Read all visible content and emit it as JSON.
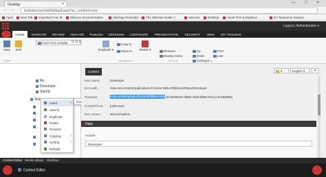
{
  "browser": {
    "tab_title": "Desktop",
    "tab_close": "×",
    "window_controls": "— □ ×",
    "back": "←",
    "forward": "→",
    "url": "test/sitecore/shell/default.aspx?sc_content=core",
    "bookmarks": [
      "Apps",
      "New Tab",
      "Imported From IE",
      "Sitecore Documentation",
      "Sitemap Generator",
      "The Ultimate Guide T...",
      "Sitecore",
      "Desktop",
      "Avoid Thin & Duplicat...",
      "It's Taxonomy Season"
    ]
  },
  "sitecore_header": {
    "user": "Logout  |  Administrator  ▾"
  },
  "ribbon_tabs": [
    "HOME",
    "NAVIGATE",
    "REVIEW",
    "ANALYZE",
    "PUBLISH",
    "VERSIONS",
    "CONFIGURE",
    "PRESENTATION",
    "SECURITY",
    "VIEW",
    "MY TOOLBAR"
  ],
  "ribbon": {
    "save": "Save",
    "edit": "Edit",
    "insert_from_template": "Insert from templat",
    "insert_counter": "(1 of 1)",
    "duplicate": "Duplicate ▾",
    "copy_to": "Copy to",
    "move_to": "Move to",
    "delete": "Delete ▾",
    "rename": "Rename",
    "display_name": "Display name",
    "up": "Up",
    "down": "Down",
    "sorting": "Sorting ▾",
    "first": "First",
    "last": "Last",
    "group_write": "Write",
    "group_operations": "Operations",
    "group_rename": "Rename",
    "group_sorting": "Sorting"
  },
  "tree": {
    "items": [
      "My",
      "Developer",
      "SiteFly",
      "Skipo",
      "",
      "",
      "",
      "",
      "",
      ""
    ]
  },
  "context_menu": {
    "items": [
      "Insert",
      "Search",
      "Duplicate",
      "Delete",
      "Rename",
      "Copying",
      "Sorting",
      "Refresh"
    ],
    "submenu": "Insert from template"
  },
  "content": {
    "tab": "Content",
    "toolbar_btn": "▾",
    "language": "English ▾",
    "nav": "▾",
    "item_name_label": "Item name:",
    "item_name_value": "Developer",
    "item_path_label": "Item path:",
    "item_path_value": "/sitecore/content/Applications/Content Editor/Ribbons/Strips/Developer",
    "template_label": "Template:",
    "template_value": "/sitecore/templates/System/Ribbon/Strip",
    "template_guid": "{EC6D8D2E-0D00-4329-8858-8AC1AD10EBB8}",
    "created_from_label": "Created from:",
    "created_from_value": "[unknown]",
    "item_owner_label": "Item owner:",
    "item_owner_value": "sitecore\\admin",
    "data_section": "Data",
    "header_label": "Header:",
    "header_value": "Developer"
  },
  "bottom_tabs": [
    "Content Editor",
    "Media Library",
    "Workbox"
  ],
  "taskbar": {
    "item": "Content Editor"
  },
  "colors": {
    "accent": "#cc3333",
    "selection": "#3399ff",
    "header_bg": "#2b2b2b"
  }
}
